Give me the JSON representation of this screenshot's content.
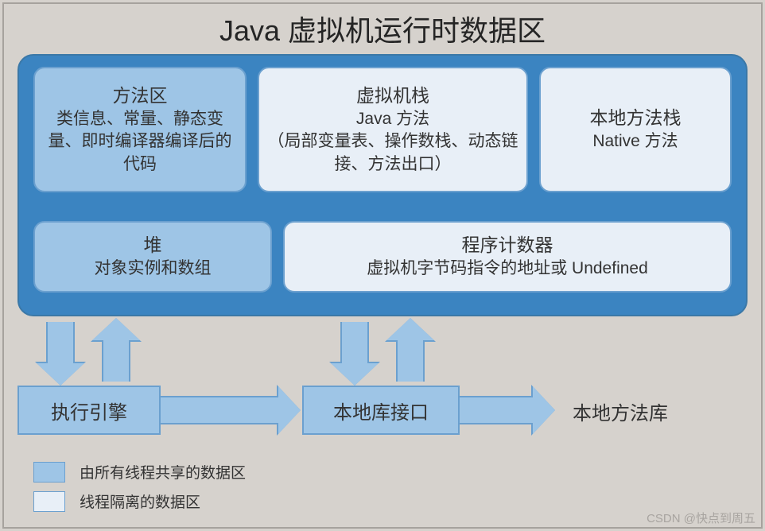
{
  "title": "Java 虚拟机运行时数据区",
  "areas": {
    "method_area": {
      "title": "方法区",
      "desc": "类信息、常量、静态变量、即时编译器编译后的代码"
    },
    "vm_stack": {
      "title": "虚拟机栈",
      "sub1": "Java 方法",
      "sub2": "（局部变量表、操作数栈、动态链接、方法出口）"
    },
    "native_stack": {
      "title": "本地方法栈",
      "sub": "Native 方法"
    },
    "heap": {
      "title": "堆",
      "desc": "对象实例和数组"
    },
    "pc": {
      "title": "程序计数器",
      "desc": "虚拟机字节码指令的地址或 Undefined"
    }
  },
  "bottom": {
    "exec_engine": "执行引擎",
    "native_interface": "本地库接口",
    "native_libs": "本地方法库"
  },
  "legend": {
    "shared": "由所有线程共享的数据区",
    "isolated": "线程隔离的数据区"
  },
  "watermark": "CSDN @快点到周五"
}
